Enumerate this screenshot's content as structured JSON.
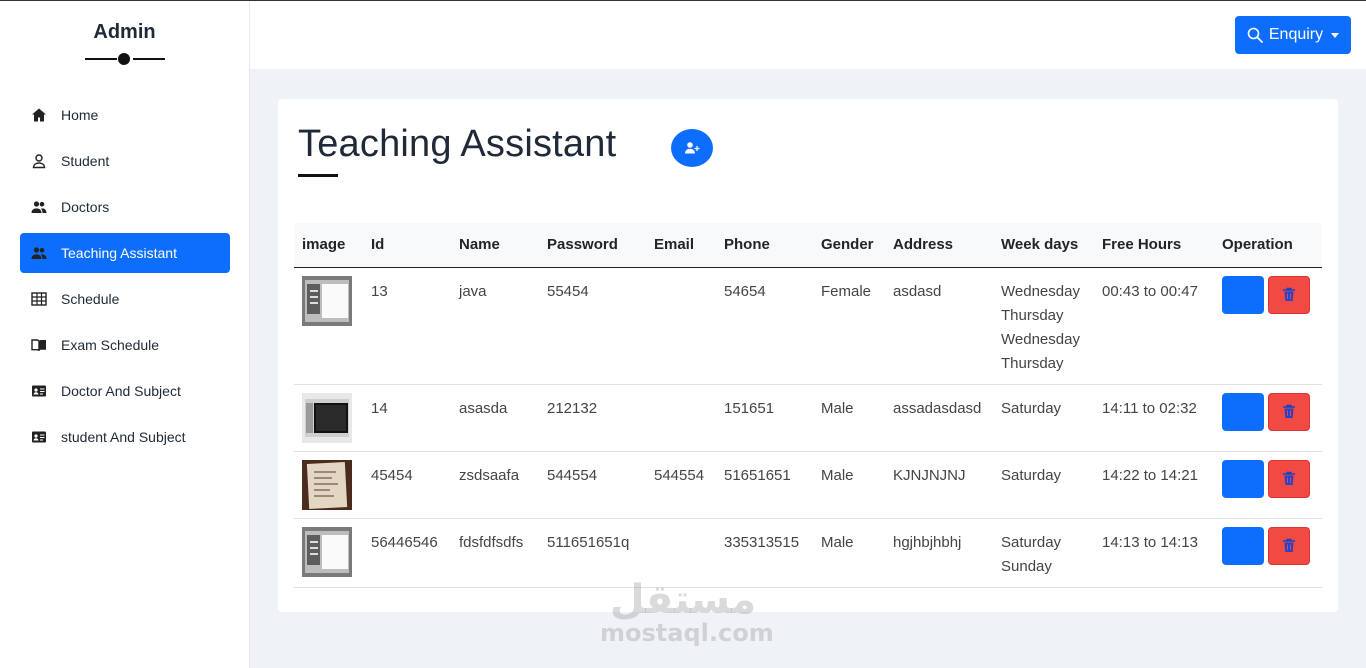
{
  "sidebar": {
    "brand": "Admin",
    "items": [
      {
        "label": "Home",
        "icon": "home-icon"
      },
      {
        "label": "Student",
        "icon": "user-icon"
      },
      {
        "label": "Doctors",
        "icon": "users-icon"
      },
      {
        "label": "Teaching Assistant",
        "icon": "users-icon",
        "active": true
      },
      {
        "label": "Schedule",
        "icon": "table-icon"
      },
      {
        "label": "Exam Schedule",
        "icon": "book-icon"
      },
      {
        "label": "Doctor And Subject",
        "icon": "id-card-icon"
      },
      {
        "label": "student And Subject",
        "icon": "id-card-icon"
      }
    ]
  },
  "topbar": {
    "enquiry_label": "Enquiry"
  },
  "main": {
    "title": "Teaching Assistant",
    "table": {
      "columns": [
        "image",
        "Id",
        "Name",
        "Password",
        "Email",
        "Phone",
        "Gender",
        "Address",
        "Week days",
        "Free Hours",
        "Operation"
      ],
      "rows": [
        {
          "id": "13",
          "name": "java",
          "password": "55454",
          "email": "",
          "phone": "54654",
          "gender": "Female",
          "address": "asdasd",
          "week_days": [
            "Wednesday",
            "Thursday",
            "Wednesday",
            "Thursday"
          ],
          "free_hours": "00:43 to 00:47",
          "thumb": "screen-light"
        },
        {
          "id": "14",
          "name": "asasda",
          "password": "212132",
          "email": "",
          "phone": "151651",
          "gender": "Male",
          "address": "assadasdasd",
          "week_days": [
            "Saturday"
          ],
          "free_hours": "14:11 to 02:32",
          "thumb": "screen-dark"
        },
        {
          "id": "45454",
          "name": "zsdsaafa",
          "password": "544554",
          "email": "544554",
          "phone": "51651651",
          "gender": "Male",
          "address": "KJNJNJNJ",
          "week_days": [
            "Saturday"
          ],
          "free_hours": "14:22 to 14:21",
          "thumb": "paper-photo"
        },
        {
          "id": "56446546",
          "name": "fdsfdfsdfs",
          "password": "511651651q",
          "email": "",
          "phone": "335313515",
          "gender": "Male",
          "address": "hgjhbjhbhj",
          "week_days": [
            "Saturday",
            "Sunday"
          ],
          "free_hours": "14:13 to 14:13",
          "thumb": "screen-light"
        }
      ]
    }
  },
  "watermark": {
    "arabic": "مستقل",
    "latin": "mostaql.com"
  },
  "colors": {
    "primary": "#0d6efd",
    "danger": "#f04a43",
    "background": "#eff2f7"
  }
}
